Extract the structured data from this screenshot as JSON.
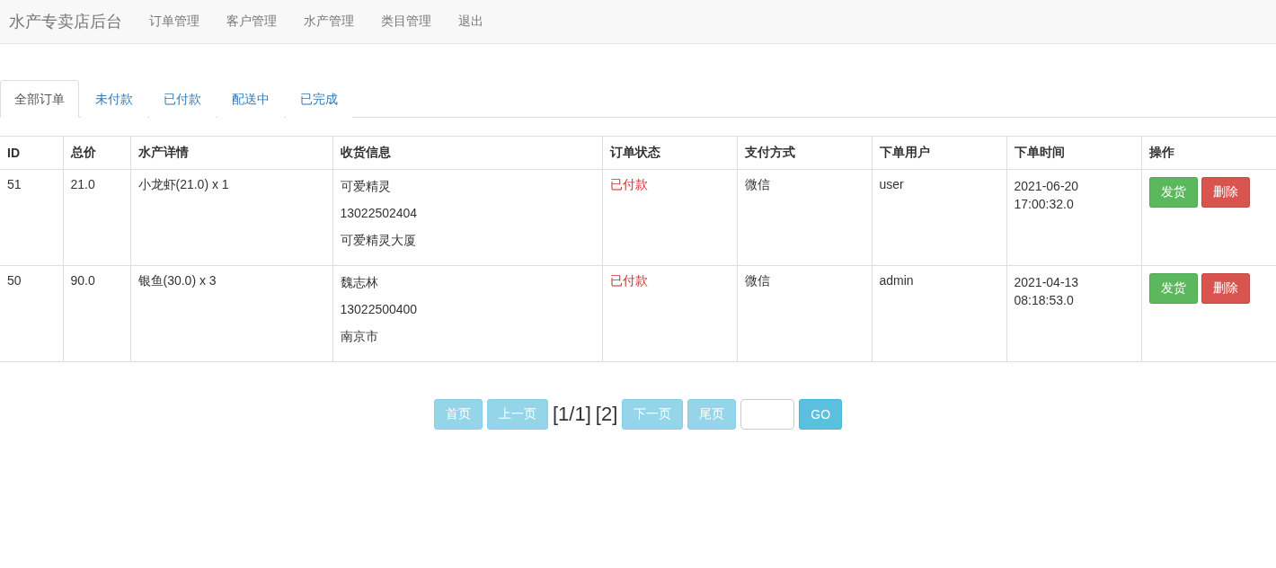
{
  "navbar": {
    "brand": "水产专卖店后台",
    "links": [
      "订单管理",
      "客户管理",
      "水产管理",
      "类目管理",
      "退出"
    ]
  },
  "tabs": [
    {
      "label": "全部订单",
      "selected": true
    },
    {
      "label": "未付款",
      "selected": false
    },
    {
      "label": "已付款",
      "selected": false
    },
    {
      "label": "配送中",
      "selected": false
    },
    {
      "label": "已完成",
      "selected": false
    }
  ],
  "table": {
    "columns": [
      "ID",
      "总价",
      "水产详情",
      "收货信息",
      "订单状态",
      "支付方式",
      "下单用户",
      "下单时间",
      "操作"
    ],
    "rows": [
      {
        "id": "51",
        "total": "21.0",
        "detail": "小龙虾(21.0) x 1",
        "receiver": [
          "可爱精灵",
          "13022502404",
          "可爱精灵大厦"
        ],
        "status": "已付款",
        "payment": "微信",
        "user": "user",
        "time": [
          "2021-06-20",
          "17:00:32.0"
        ],
        "actions": [
          {
            "label": "发货",
            "kind": "success"
          },
          {
            "label": "删除",
            "kind": "danger"
          }
        ]
      },
      {
        "id": "50",
        "total": "90.0",
        "detail": "银鱼(30.0) x 3",
        "receiver": [
          "魏志林",
          "13022500400",
          "南京市"
        ],
        "status": "已付款",
        "payment": "微信",
        "user": "admin",
        "time": [
          "2021-04-13",
          "08:18:53.0"
        ],
        "actions": [
          {
            "label": "发货",
            "kind": "success"
          },
          {
            "label": "删除",
            "kind": "danger"
          }
        ]
      }
    ]
  },
  "pagination": {
    "before": [
      {
        "label": "首页",
        "disabled": true
      },
      {
        "label": "上一页",
        "disabled": true
      }
    ],
    "page_info": [
      "[1/1]",
      "[2]"
    ],
    "after": [
      {
        "label": "下一页",
        "disabled": true
      },
      {
        "label": "尾页",
        "disabled": true
      }
    ],
    "go": {
      "label": "GO",
      "disabled": false
    }
  }
}
